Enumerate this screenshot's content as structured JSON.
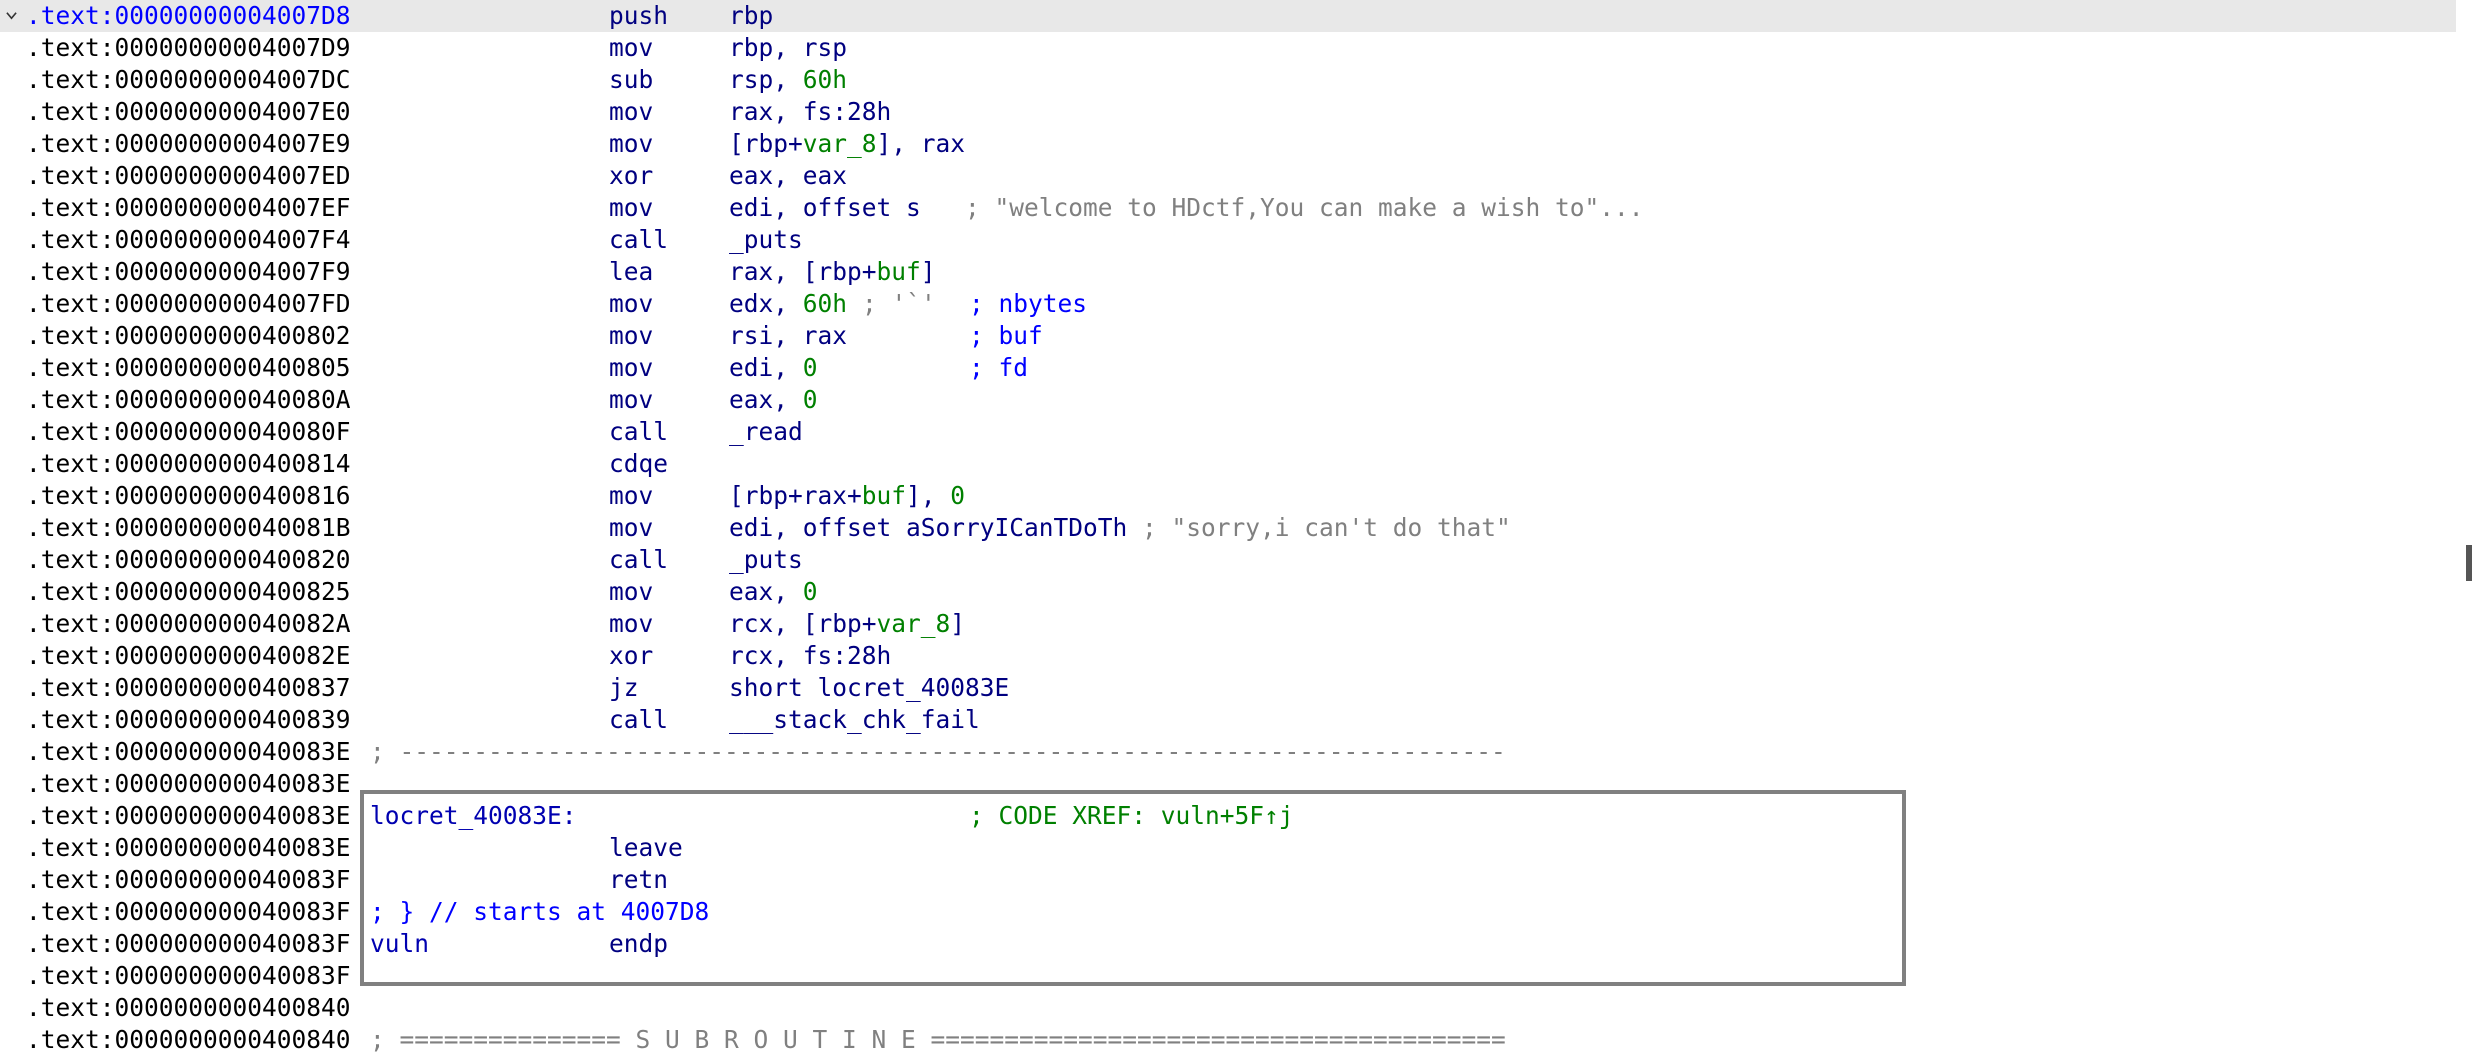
{
  "listing": {
    "current_address": ".text:00000000004007D8",
    "lines": [
      {
        "addr": ".text:00000000004007D8",
        "mnem": "push",
        "ops": "rbp"
      },
      {
        "addr": ".text:00000000004007D9",
        "mnem": "mov",
        "ops": "rbp, rsp"
      },
      {
        "addr": ".text:00000000004007DC",
        "mnem": "sub",
        "ops_a": "rsp, ",
        "ops_num": "60h"
      },
      {
        "addr": ".text:00000000004007E0",
        "mnem": "mov",
        "ops": "rax, fs:28h"
      },
      {
        "addr": ".text:00000000004007E9",
        "mnem": "mov",
        "ops_a": "[rbp+",
        "ops_var": "var_8",
        "ops_b": "], rax"
      },
      {
        "addr": ".text:00000000004007ED",
        "mnem": "xor",
        "ops": "eax, eax"
      },
      {
        "addr": ".text:00000000004007EF",
        "mnem": "mov",
        "ops": "edi, offset s",
        "comment": "; \"welcome to HDctf,You can make a wish to\"..."
      },
      {
        "addr": ".text:00000000004007F4",
        "mnem": "call",
        "ops": "_puts"
      },
      {
        "addr": ".text:00000000004007F9",
        "mnem": "lea",
        "ops_a": "rax, [rbp+",
        "ops_var": "buf",
        "ops_b": "]"
      },
      {
        "addr": ".text:00000000004007FD",
        "mnem": "mov",
        "ops_a": "edx, ",
        "ops_num": "60h",
        "comment_gray": "; '`'",
        "comment": "; nbytes"
      },
      {
        "addr": ".text:0000000000400802",
        "mnem": "mov",
        "ops": "rsi, rax",
        "comment": "; buf"
      },
      {
        "addr": ".text:0000000000400805",
        "mnem": "mov",
        "ops_a": "edi, ",
        "ops_num": "0",
        "comment": "; fd"
      },
      {
        "addr": ".text:000000000040080A",
        "mnem": "mov",
        "ops_a": "eax, ",
        "ops_num": "0"
      },
      {
        "addr": ".text:000000000040080F",
        "mnem": "call",
        "ops": "_read"
      },
      {
        "addr": ".text:0000000000400814",
        "mnem": "cdqe",
        "ops": ""
      },
      {
        "addr": ".text:0000000000400816",
        "mnem": "mov",
        "ops_a": "[rbp+rax+",
        "ops_var": "buf",
        "ops_b": "], ",
        "ops_num2": "0"
      },
      {
        "addr": ".text:000000000040081B",
        "mnem": "mov",
        "ops": "edi, offset aSorryICanTDoTh",
        "comment_gray": "; \"sorry,i can't do that\""
      },
      {
        "addr": ".text:0000000000400820",
        "mnem": "call",
        "ops": "_puts"
      },
      {
        "addr": ".text:0000000000400825",
        "mnem": "mov",
        "ops_a": "eax, ",
        "ops_num": "0"
      },
      {
        "addr": ".text:000000000040082A",
        "mnem": "mov",
        "ops_a": "rcx, [rbp+",
        "ops_var": "var_8",
        "ops_b": "]"
      },
      {
        "addr": ".text:000000000040082E",
        "mnem": "xor",
        "ops": "rcx, fs:28h"
      },
      {
        "addr": ".text:0000000000400837",
        "mnem": "jz",
        "ops": "short locret_40083E"
      },
      {
        "addr": ".text:0000000000400839",
        "mnem": "call",
        "ops": "___stack_chk_fail"
      },
      {
        "addr": ".text:000000000040083E",
        "separator": "; ---------------------------------------------------------------------------"
      },
      {
        "addr": ".text:000000000040083E"
      },
      {
        "addr": ".text:000000000040083E",
        "label": "locret_40083E:",
        "comment": "; CODE XREF: vuln+5F↑j"
      },
      {
        "addr": ".text:000000000040083E",
        "mnem": "leave",
        "ops": ""
      },
      {
        "addr": ".text:000000000040083F",
        "mnem": "retn",
        "ops": ""
      },
      {
        "addr": ".text:000000000040083F",
        "label": "; } // starts at 4007D8"
      },
      {
        "addr": ".text:000000000040083F",
        "label": "vuln",
        "mnem": "endp",
        "ops": ""
      },
      {
        "addr": ".text:000000000040083F"
      },
      {
        "addr": ".text:0000000000400840"
      },
      {
        "addr": ".text:0000000000400840",
        "separator": "; =============== S U B R O U T I N E ======================================="
      }
    ]
  },
  "colors": {
    "highlight_row": "#e8e8e8",
    "address_current": "#0000ff",
    "mnemonic": "#000080",
    "variable": "#008000",
    "comment_blue": "#0000ff",
    "comment_gray": "#808080",
    "label": "#0000b0",
    "box_border": "#808080"
  },
  "icons": {
    "collapse": "chevron-down-icon"
  }
}
